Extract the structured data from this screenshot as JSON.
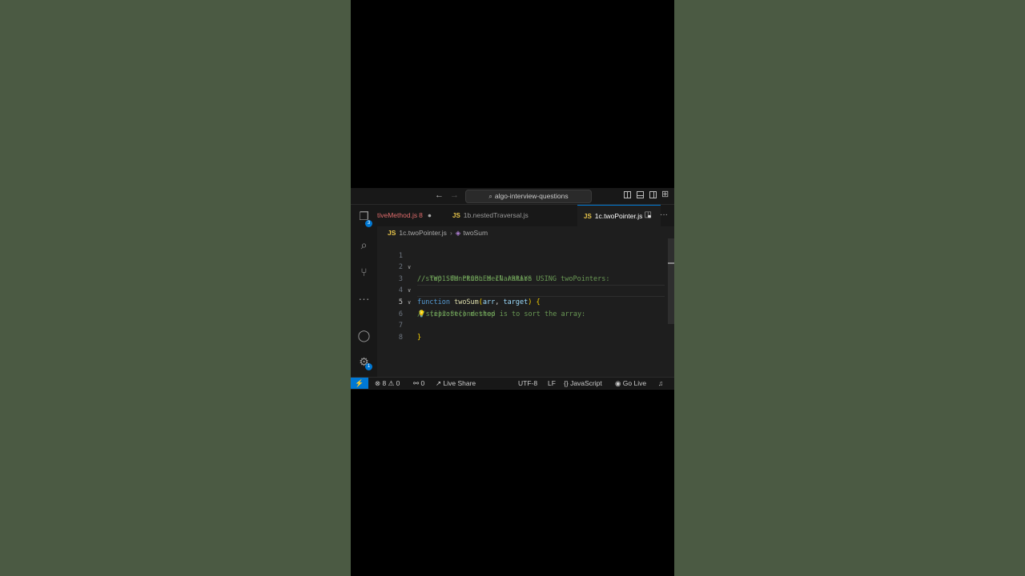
{
  "titlebar": {
    "search": "algo-interview-questions"
  },
  "tabs": [
    {
      "name": "tiveMethod.js",
      "problems": "8",
      "modified": "●"
    },
    {
      "name": "1b.nestedTraversal.js"
    },
    {
      "name": "1c.twoPointer.js",
      "modified": "●"
    }
  ],
  "file_icon_label": "JS",
  "breadcrumb": {
    "file": "1c.twoPointer.js",
    "separator": "›",
    "symbol": "twoSum"
  },
  "activity_badges": {
    "explorer": "3",
    "settings": "1"
  },
  "editor": {
    "active_line": 5,
    "lines": [
      {
        "n": "1",
        "text": "// TWO SUM PROBLEM IN ARRAYS USING twoPointers:"
      },
      {
        "n": "2",
        "text": "//step1:function declaration"
      },
      {
        "n": "3",
        "kw": "function",
        "fn": "twoSum",
        "open": "(",
        "p1": "arr",
        "comma": ", ",
        "p2": "target",
        "close": ")",
        "brace": "{"
      },
      {
        "n": "4",
        "text": "step2:Second step is to sort the array:"
      },
      {
        "n": "5",
        "text": "// (i)sort() method"
      },
      {
        "n": "6",
        "text": ""
      },
      {
        "n": "7",
        "text": "}"
      },
      {
        "n": "8",
        "text": ""
      }
    ]
  },
  "statusbar": {
    "errors": "8",
    "warnings": "0",
    "ports": "0",
    "live_share": "Live Share",
    "encoding": "UTF-8",
    "eol": "LF",
    "language": "JavaScript",
    "go_live": "Go Live"
  },
  "colors": {
    "remote": "#0078d4",
    "comment": "#6a9955",
    "keyword": "#569cd6",
    "function": "#dcdcaa",
    "param": "#9cdcfe",
    "bracket": "#ffd700"
  }
}
